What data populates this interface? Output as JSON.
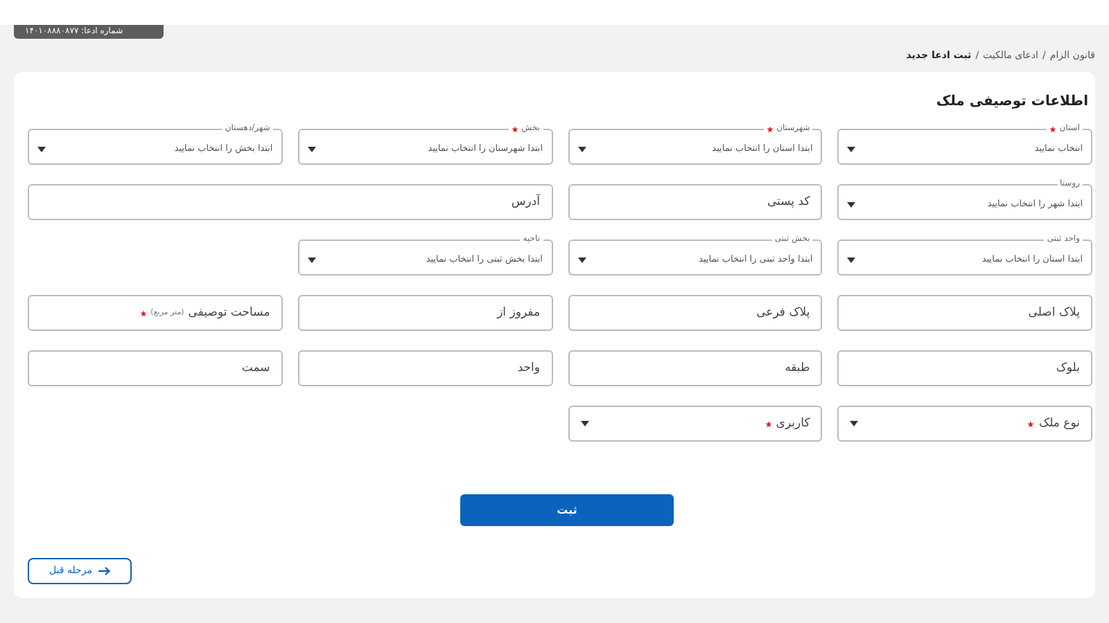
{
  "claim_badge": "شماره ادعا: ۱۴۰۱۰۸۸۸۰۸۷۷",
  "breadcrumb": {
    "separator": "/",
    "items": [
      {
        "label": "قانون الزام",
        "current": false
      },
      {
        "label": "ادعای مالکیت",
        "current": false
      },
      {
        "label": "ثبت ادعا جدید",
        "current": true
      }
    ]
  },
  "section_title": "اطلاعات توصیفی ملک",
  "rows": [
    {
      "fields": [
        {
          "kind": "select",
          "label": "استان",
          "required": true,
          "value": "انتخاب نمایید"
        },
        {
          "kind": "select",
          "label": "شهرستان",
          "required": true,
          "value": "ابتدا استان را انتخاب نمایید"
        },
        {
          "kind": "select",
          "label": "بخش",
          "required": true,
          "value": "ابتدا شهرستان را انتخاب نمایید"
        },
        {
          "kind": "select",
          "label": "شهر/دهستان",
          "required": false,
          "value": "ابتدا بخش را انتخاب نمایید"
        }
      ]
    },
    {
      "fields": [
        {
          "kind": "select",
          "label": "روستا",
          "required": false,
          "value": "ابتدا شهر را انتخاب نمایید"
        },
        {
          "kind": "input",
          "placeholder": "کد پستی",
          "required": false
        },
        {
          "kind": "input",
          "placeholder": "آدرس",
          "required": false,
          "wide": true
        }
      ]
    },
    {
      "fields": [
        {
          "kind": "select",
          "label": "واحد ثبتی",
          "required": false,
          "value": "ابتدا استان را انتخاب نمایید"
        },
        {
          "kind": "select",
          "label": "بخش ثبتی",
          "required": false,
          "value": "ابتدا واحد ثبتی را انتخاب نمایید"
        },
        {
          "kind": "select",
          "label": "ناحیه",
          "required": false,
          "value": "ابتدا بخش ثبتی را انتخاب نمایید"
        }
      ]
    },
    {
      "fields": [
        {
          "kind": "input",
          "placeholder": "پلاک اصلی",
          "required": false
        },
        {
          "kind": "input",
          "placeholder": "پلاک فرعی",
          "required": false
        },
        {
          "kind": "input",
          "placeholder": "مفروز از",
          "required": false
        },
        {
          "kind": "input",
          "placeholder": "مساحت توصیفی",
          "unit": "(متر مربع)",
          "required": true
        }
      ]
    },
    {
      "fields": [
        {
          "kind": "input",
          "placeholder": "بلوک",
          "required": false
        },
        {
          "kind": "input",
          "placeholder": "طبقه",
          "required": false
        },
        {
          "kind": "input",
          "placeholder": "واحد",
          "required": false
        },
        {
          "kind": "input",
          "placeholder": "سمت",
          "required": false
        }
      ]
    },
    {
      "fields": [
        {
          "kind": "dropdown",
          "placeholder": "نوع ملک",
          "required": true
        },
        {
          "kind": "dropdown",
          "placeholder": "کاربری",
          "required": true
        }
      ]
    }
  ],
  "submit_button": "ثبت",
  "back_button": "مرحله قبل"
}
